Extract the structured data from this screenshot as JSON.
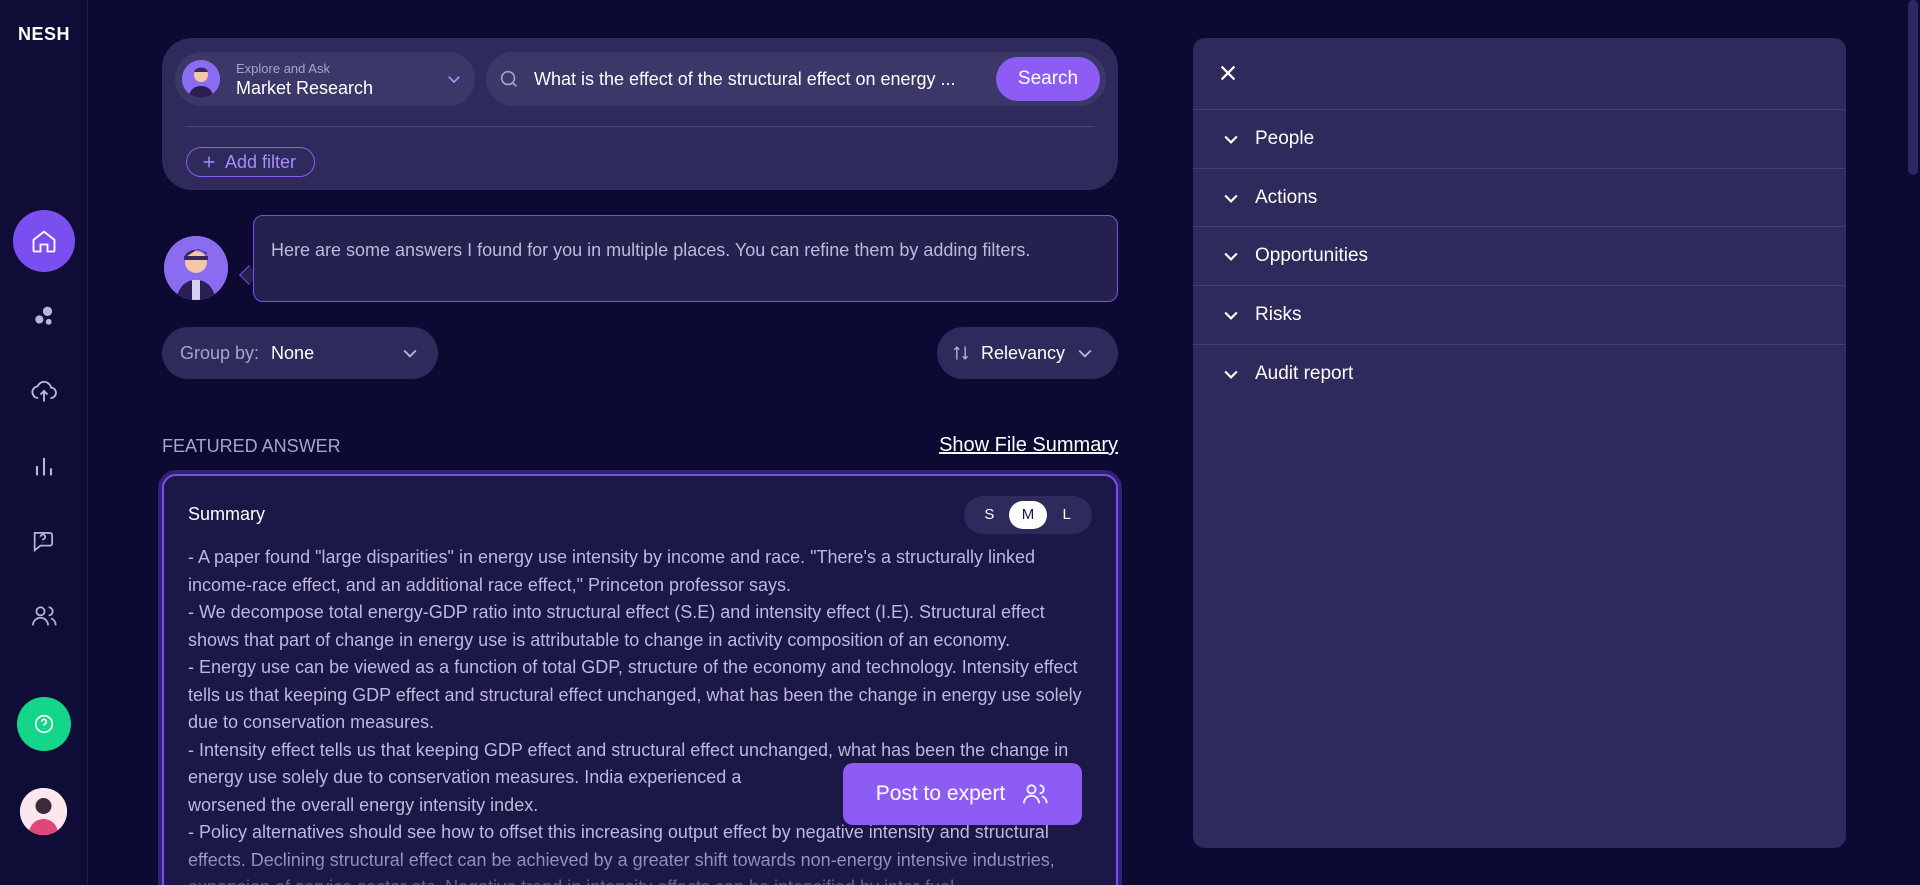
{
  "app": {
    "logo": "NESH"
  },
  "search": {
    "context_small": "Explore and Ask",
    "context_main": "Market Research",
    "query": "What is the effect of the structural effect on energy ...",
    "button": "Search",
    "add_filter": "Add filter"
  },
  "assistant": {
    "message": "Here are some answers I found for you in multiple places. You can refine them by adding filters."
  },
  "controls": {
    "group_label": "Group by:",
    "group_value": "None",
    "sort_value": "Relevancy"
  },
  "featured": {
    "label": "FEATURED ANSWER",
    "show_summary": "Show File Summary",
    "title": "Summary",
    "sizes": [
      "S",
      "M",
      "L"
    ],
    "active_size": "M",
    "lines": [
      "- A paper found \"large disparities\" in energy use intensity by income and race. \"There's a structurally linked income-race effect, and an additional race effect,\" Princeton professor says.",
      "- We decompose total energy-GDP ratio into structural effect (S.E) and intensity effect (I.E). Structural effect shows that part of change in energy use is attributable to change in activity composition of an economy.",
      "- Energy use can be viewed as a function of total GDP, structure of the economy and technology. Intensity effect tells us that keeping GDP effect and structural effect unchanged, what has been the change in energy use solely due to conservation measures.",
      "- Intensity effect tells us that keeping GDP effect and structural effect unchanged, what has been the change in energy use solely due to conservation measures. India experienced a",
      "worsened the overall energy intensity index.",
      "- Policy alternatives should see how to offset this increasing output effect by negative intensity and structural effects. Declining structural effect can be achieved by a greater shift towards non-energy intensive industries, expansion of service sector etc. Negative trend in intensity effects can be intensified by inter-fuel"
    ],
    "post_expert": "Post to expert"
  },
  "panel": {
    "sections": [
      "People",
      "Actions",
      "Opportunities",
      "Risks",
      "Audit report"
    ]
  },
  "colors": {
    "accent": "#8c5cf5",
    "background": "#0c0a33",
    "help": "#14d68a"
  }
}
